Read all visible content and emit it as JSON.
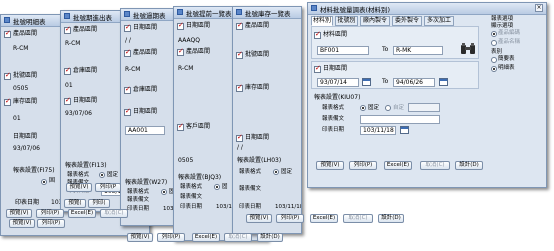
{
  "buttons": {
    "preview": "預覽(V)",
    "print": "列印(P)",
    "excel": "Excel(E)",
    "cancel": "取消(C)",
    "setup": "設計(D)",
    "preview_short": "預覽(V)",
    "print_short": "列印(P",
    "excel_short": "Excel(E)",
    "cancel_short": "取消(C)",
    "setup_short": "設計(D)",
    "preview_trunc": "預覽(",
    "print_trunc": "列印("
  },
  "common": {
    "report_settings": "報表設置",
    "report_format": "報表格式",
    "report_note": "報表備文",
    "print_date": "印表日期",
    "format_fixed": "固定",
    "format_custom": "自定",
    "to_label": "To"
  },
  "win1": {
    "title": "批號明細表",
    "f1": "產品區間",
    "v1": "R-CM",
    "f2": "批號區間",
    "v2": "0505",
    "f3": "庫存區間",
    "v3": "01",
    "f4": "日期區間",
    "v4": "93/07/06",
    "settings": "報表設置(FI75)",
    "radio_label": "固",
    "date_label": "印表日期",
    "date_value": "103/11"
  },
  "win2": {
    "title": "批號期進出表",
    "f1": "產品區間",
    "v1": "R-CM",
    "f2": "倉庫區間",
    "v2": "01",
    "f3": "日期區間",
    "v3": "93/07/06",
    "settings": "報表設置(FI13)",
    "fmt_label": "報表格式",
    "radio_label": "固定",
    "note_label": "報表備文",
    "date_label": "印表日期",
    "date_value": "103/11/1"
  },
  "win3": {
    "title": "批號過期表",
    "f1": "日期區間",
    "v1": "/ /",
    "f2": "產品區間",
    "v2": "R-CM",
    "f3": "倉庫區間",
    "v3": "AA001",
    "f4": "日期區間",
    "settings": "報表設置(W27)",
    "fmt_label": "報表格式",
    "radio_label": "固",
    "note_label": "報表備文",
    "date_label": "印表日期",
    "date_value": "103/1"
  },
  "win4": {
    "title": "批號提前一覽表",
    "f1": "日期區間",
    "v1": "AAAQQ",
    "f2": "產品區間",
    "v2": "R-CM",
    "f3": "客戶區間",
    "v3": "0505",
    "settings": "報表設置(BJQ3)",
    "fmt_label": "報表格式",
    "radio_label": "固",
    "note_label": "報表備文",
    "date_label": "印表日期",
    "date_value": "103/11/18"
  },
  "win5": {
    "title": "批號庫存一覽表",
    "f1": "產品區間",
    "f2": "批號區間",
    "f3": "庫存區間",
    "f4": "日期區間",
    "v4": "/ /",
    "settings": "報表設置(LH03)",
    "fmt_label": "報表格式",
    "radio_label": "固定",
    "note_label": "報表備文",
    "date_label": "印表日期",
    "date_value": "103/11/18"
  },
  "main": {
    "title": "材料批號量調表(材料別)",
    "tabs": [
      "材料別",
      "批號別",
      "廠內製令",
      "委外製令",
      "多次加工"
    ],
    "f1": "材料區間",
    "from1": "BF001",
    "to1": "R-MK",
    "f2": "日期區間",
    "from2": "93/07/14",
    "to2": "94/06/26",
    "settings": "報表設置(KIU07)",
    "fmt_label": "報表格式",
    "radio_fixed": "固定",
    "radio_custom": "自定",
    "note_label": "報表備文",
    "date_label": "印表日期",
    "date_value": "103/11/18",
    "side_head": "報表選項",
    "side_sub": "顯示選項",
    "opt1": "產品編碼",
    "opt2": "產品名稱",
    "type_label": "表別",
    "type1": "簡要表",
    "type2": "明細表"
  }
}
